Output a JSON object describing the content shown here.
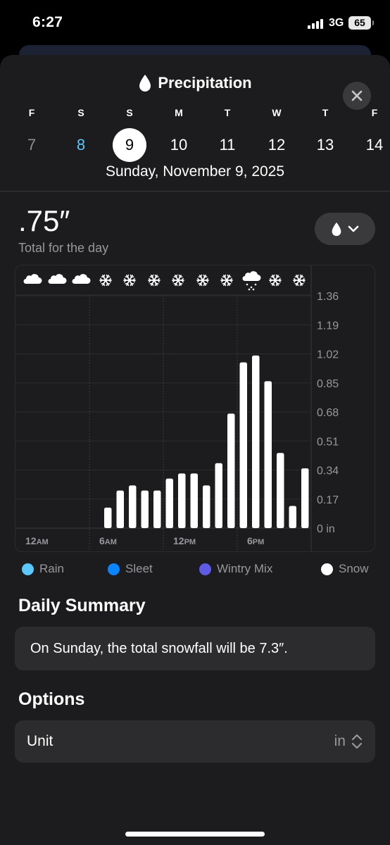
{
  "status_bar": {
    "time": "6:27",
    "network": "3G",
    "battery": "65"
  },
  "sheet": {
    "title": "Precipitation",
    "title_icon": "raindrop-icon",
    "close_icon": "close-icon"
  },
  "days": [
    {
      "letter": "F",
      "number": "7",
      "state": "past"
    },
    {
      "letter": "S",
      "number": "8",
      "state": "today"
    },
    {
      "letter": "S",
      "number": "9",
      "state": "selected"
    },
    {
      "letter": "M",
      "number": "10",
      "state": "future"
    },
    {
      "letter": "T",
      "number": "11",
      "state": "future"
    },
    {
      "letter": "W",
      "number": "12",
      "state": "future"
    },
    {
      "letter": "T",
      "number": "13",
      "state": "future"
    },
    {
      "letter": "F",
      "number": "14",
      "state": "future"
    }
  ],
  "selected_date": "Sunday, November 9, 2025",
  "total": {
    "value": ".75″",
    "label": "Total for the day"
  },
  "type_selector": {
    "icon": "raindrop-icon",
    "chevron": "chevron-down-icon"
  },
  "chart_data": {
    "type": "bar",
    "ylabel": "in",
    "yticks": [
      "1.36",
      "1.19",
      "1.02",
      "0.85",
      "0.68",
      "0.51",
      "0.34",
      "0.17",
      "0 in"
    ],
    "ylim": [
      0,
      1.36
    ],
    "xticks": [
      {
        "hour": 0,
        "label": "12",
        "suffix": "AM"
      },
      {
        "hour": 6,
        "label": "6",
        "suffix": "AM"
      },
      {
        "hour": 12,
        "label": "12",
        "suffix": "PM"
      },
      {
        "hour": 18,
        "label": "6",
        "suffix": "PM"
      }
    ],
    "hours": [
      0,
      1,
      2,
      3,
      4,
      5,
      6,
      7,
      8,
      9,
      10,
      11,
      12,
      13,
      14,
      15,
      16,
      17,
      18,
      19,
      20,
      21,
      22,
      23
    ],
    "values": [
      0,
      0,
      0,
      0,
      0,
      0,
      0,
      0.12,
      0.22,
      0.25,
      0.22,
      0.22,
      0.29,
      0.32,
      0.32,
      0.25,
      0.38,
      0.67,
      0.97,
      1.01,
      0.86,
      0.44,
      0.13,
      0.35
    ],
    "bar_color": "#ffffff",
    "condition_icons": [
      "cloud-icon",
      "cloud-icon",
      "cloud-icon",
      "snowflake-icon",
      "snowflake-icon",
      "snowflake-icon",
      "snowflake-icon",
      "snowflake-icon",
      "snowflake-icon",
      "cloud-snow-icon",
      "snowflake-icon",
      "snowflake-icon"
    ]
  },
  "legend": [
    {
      "label": "Rain",
      "color": "#5ac8fa"
    },
    {
      "label": "Sleet",
      "color": "#0a84ff"
    },
    {
      "label": "Wintry Mix",
      "color": "#5e5ce6"
    },
    {
      "label": "Snow",
      "color": "#ffffff"
    }
  ],
  "daily_summary": {
    "heading": "Daily Summary",
    "text": "On Sunday, the total snowfall will be 7.3″."
  },
  "options": {
    "heading": "Options",
    "unit_label": "Unit",
    "unit_value": "in"
  }
}
